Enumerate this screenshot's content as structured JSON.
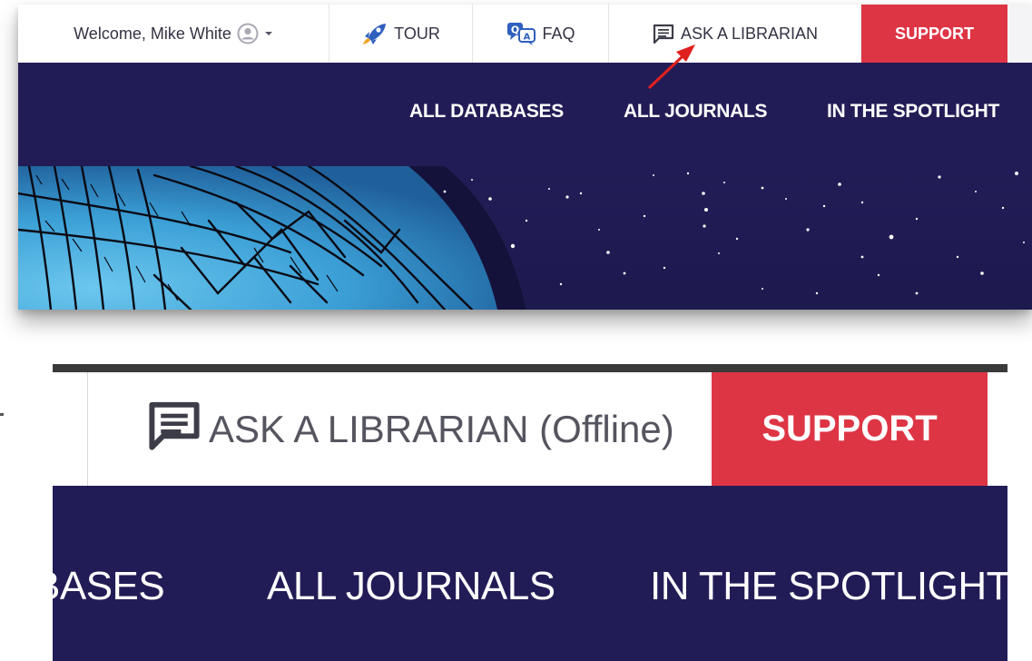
{
  "panel_small": {
    "topbar": {
      "welcome_text": "Welcome, Mike White",
      "tour_label": "TOUR",
      "faq_label": "FAQ",
      "ask_label": "ASK A LIBRARIAN",
      "support_label": "SUPPORT"
    },
    "nav": {
      "items": [
        "ALL DATABASES",
        "ALL JOURNALS",
        "IN THE SPOTLIGHT"
      ]
    },
    "icons": {
      "avatar": "user-circle-icon",
      "caret": "caret-down-icon",
      "tour": "rocket-icon",
      "faq": "faq-bubbles-icon",
      "ask": "chat-message-icon"
    }
  },
  "panel_zoom": {
    "ask_label": "ASK A LIBRARIAN (Offline)",
    "support_label": "SUPPORT",
    "nav": {
      "items": [
        "BASES",
        "ALL JOURNALS",
        "IN THE SPOTLIGHT"
      ]
    }
  },
  "colors": {
    "navy": "#221c56",
    "support_red": "#de3545",
    "annotation_arrow": "#e0201e"
  }
}
